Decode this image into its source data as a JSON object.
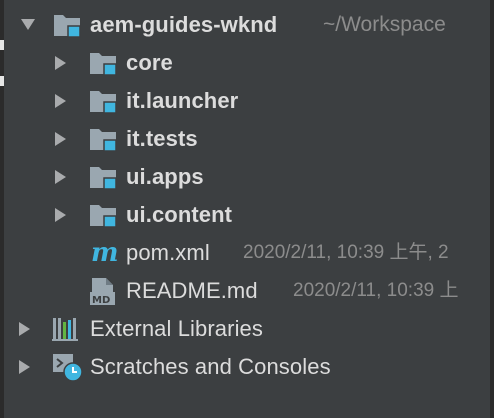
{
  "colors": {
    "panel_background": "#3c3f41",
    "text": "#dcdcdc",
    "secondary_text": "#8c8c8c",
    "folder_icon": "#9aa7b0",
    "module_badge": "#40b6e0",
    "arrow": "#a9abad"
  },
  "project": {
    "name": "aem-guides-wknd",
    "path": "~/Workspace",
    "expanded": true,
    "icon": "folder-module-icon"
  },
  "modules": [
    {
      "label": "core",
      "icon": "folder-module-icon"
    },
    {
      "label": "it.launcher",
      "icon": "folder-module-icon"
    },
    {
      "label": "it.tests",
      "icon": "folder-module-icon"
    },
    {
      "label": "ui.apps",
      "icon": "folder-module-icon"
    },
    {
      "label": "ui.content",
      "icon": "folder-module-icon"
    }
  ],
  "files": [
    {
      "label": "pom.xml",
      "meta": "2020/2/11, 10:39 上午, 2",
      "icon": "maven-icon"
    },
    {
      "label": "README.md",
      "meta": "2020/2/11, 10:39 上",
      "icon": "markdown-icon"
    }
  ],
  "top_level": [
    {
      "label": "External Libraries",
      "icon": "libraries-icon"
    },
    {
      "label": "Scratches and Consoles",
      "icon": "scratches-icon"
    }
  ],
  "icon_glyphs": {
    "maven_letter": "m",
    "markdown_badge": "MD"
  }
}
